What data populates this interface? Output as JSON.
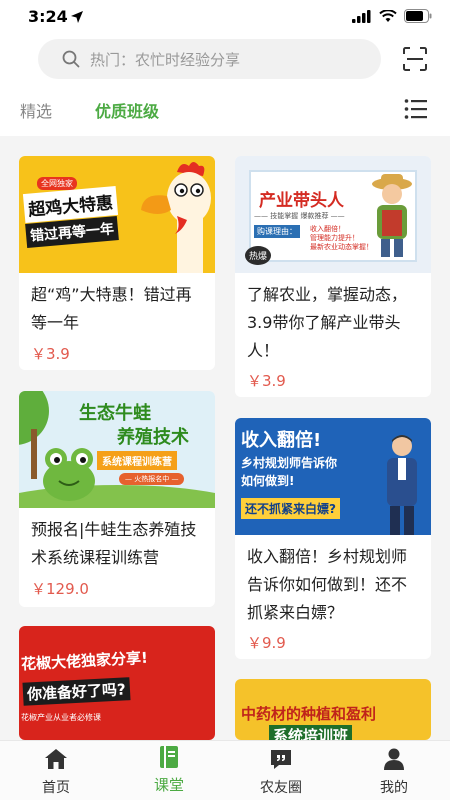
{
  "status_bar": {
    "time": "3:24"
  },
  "search": {
    "placeholder": "热门：农忙时经验分享"
  },
  "tabs": [
    {
      "label": "精选",
      "active": false
    },
    {
      "label": "优质班级",
      "active": true
    }
  ],
  "courses": [
    {
      "title": "超“鸡”大特惠！错过再等一年",
      "price": "￥3.9",
      "banner": [
        "全网独家",
        "超鸡大特惠",
        "错过再等一年"
      ]
    },
    {
      "title": "了解农业，掌握动态，3.9带你了解产业带头人！",
      "price": "￥3.9",
      "banner": [
        "产业带头人",
        "—— 技能掌握 爆款推荐 ——",
        "购课理由：",
        "收入翻倍！",
        "管理能力提升！",
        "最新农业动态掌握！",
        "热爆"
      ]
    },
    {
      "title": "预报名|牛蛙生态养殖技术系统课程训练营",
      "price": "￥129.0",
      "banner": [
        "生态牛蛙",
        "养殖技术",
        "系统课程训练营",
        "— 火热报名中 —"
      ]
    },
    {
      "title": "收入翻倍！乡村规划师告诉你如何做到！还不抓紧来白嫖？",
      "price": "￥9.9",
      "banner": [
        "收入翻倍!",
        "乡村规划师告诉你",
        "如何做到!",
        "还不抓紧来白嫖?"
      ]
    },
    {
      "banner": [
        "花椒大佬独家分享!",
        "你准备好了吗?",
        "花椒产业从业者必修课"
      ]
    },
    {
      "banner": [
        "中药材的种植和盈利",
        "系统培训班"
      ]
    }
  ],
  "nav": [
    {
      "label": "首页",
      "icon": "home-icon",
      "active": false
    },
    {
      "label": "课堂",
      "icon": "classroom-icon",
      "active": true
    },
    {
      "label": "农友圈",
      "icon": "community-icon",
      "active": false
    },
    {
      "label": "我的",
      "icon": "profile-icon",
      "active": false
    }
  ],
  "colors": {
    "accent": "#4caa43",
    "price": "#e25a4e",
    "background": "#f4f4f4"
  }
}
